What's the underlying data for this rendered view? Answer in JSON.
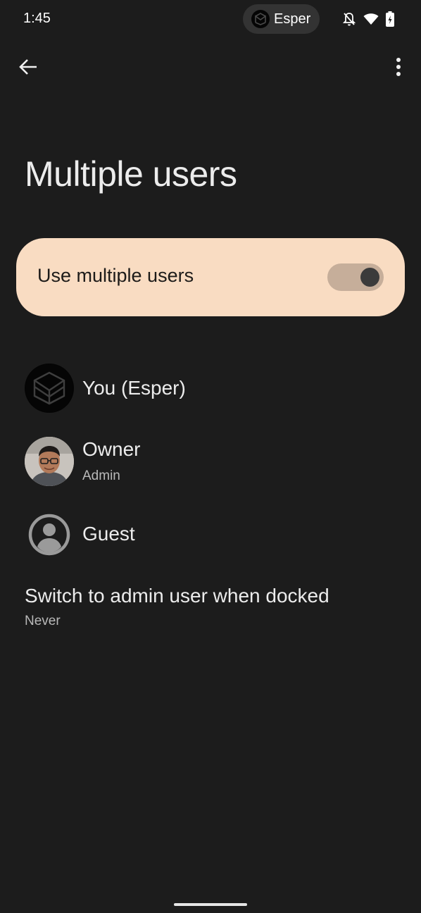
{
  "status_bar": {
    "time": "1:45",
    "app_pill_label": "Esper",
    "icons": [
      "esper-logo-icon",
      "notifications-off-icon",
      "wifi-icon",
      "battery-charging-icon"
    ]
  },
  "toolbar": {
    "back_icon": "arrow-back-icon",
    "more_icon": "more-vert-icon"
  },
  "page": {
    "title": "Multiple users"
  },
  "main_switch": {
    "label": "Use multiple users",
    "checked": true,
    "colors": {
      "background": "#f9dcc2",
      "track": "#c6ae9a",
      "thumb": "#3b3b3b"
    }
  },
  "users": [
    {
      "name": "You (Esper)",
      "subtitle": "",
      "avatar": "esper-logo-icon"
    },
    {
      "name": "Owner",
      "subtitle": "Admin",
      "avatar": "person-photo"
    },
    {
      "name": "Guest",
      "subtitle": "",
      "avatar": "account-circle-icon"
    }
  ],
  "docked_setting": {
    "title": "Switch to admin user when docked",
    "value": "Never"
  }
}
